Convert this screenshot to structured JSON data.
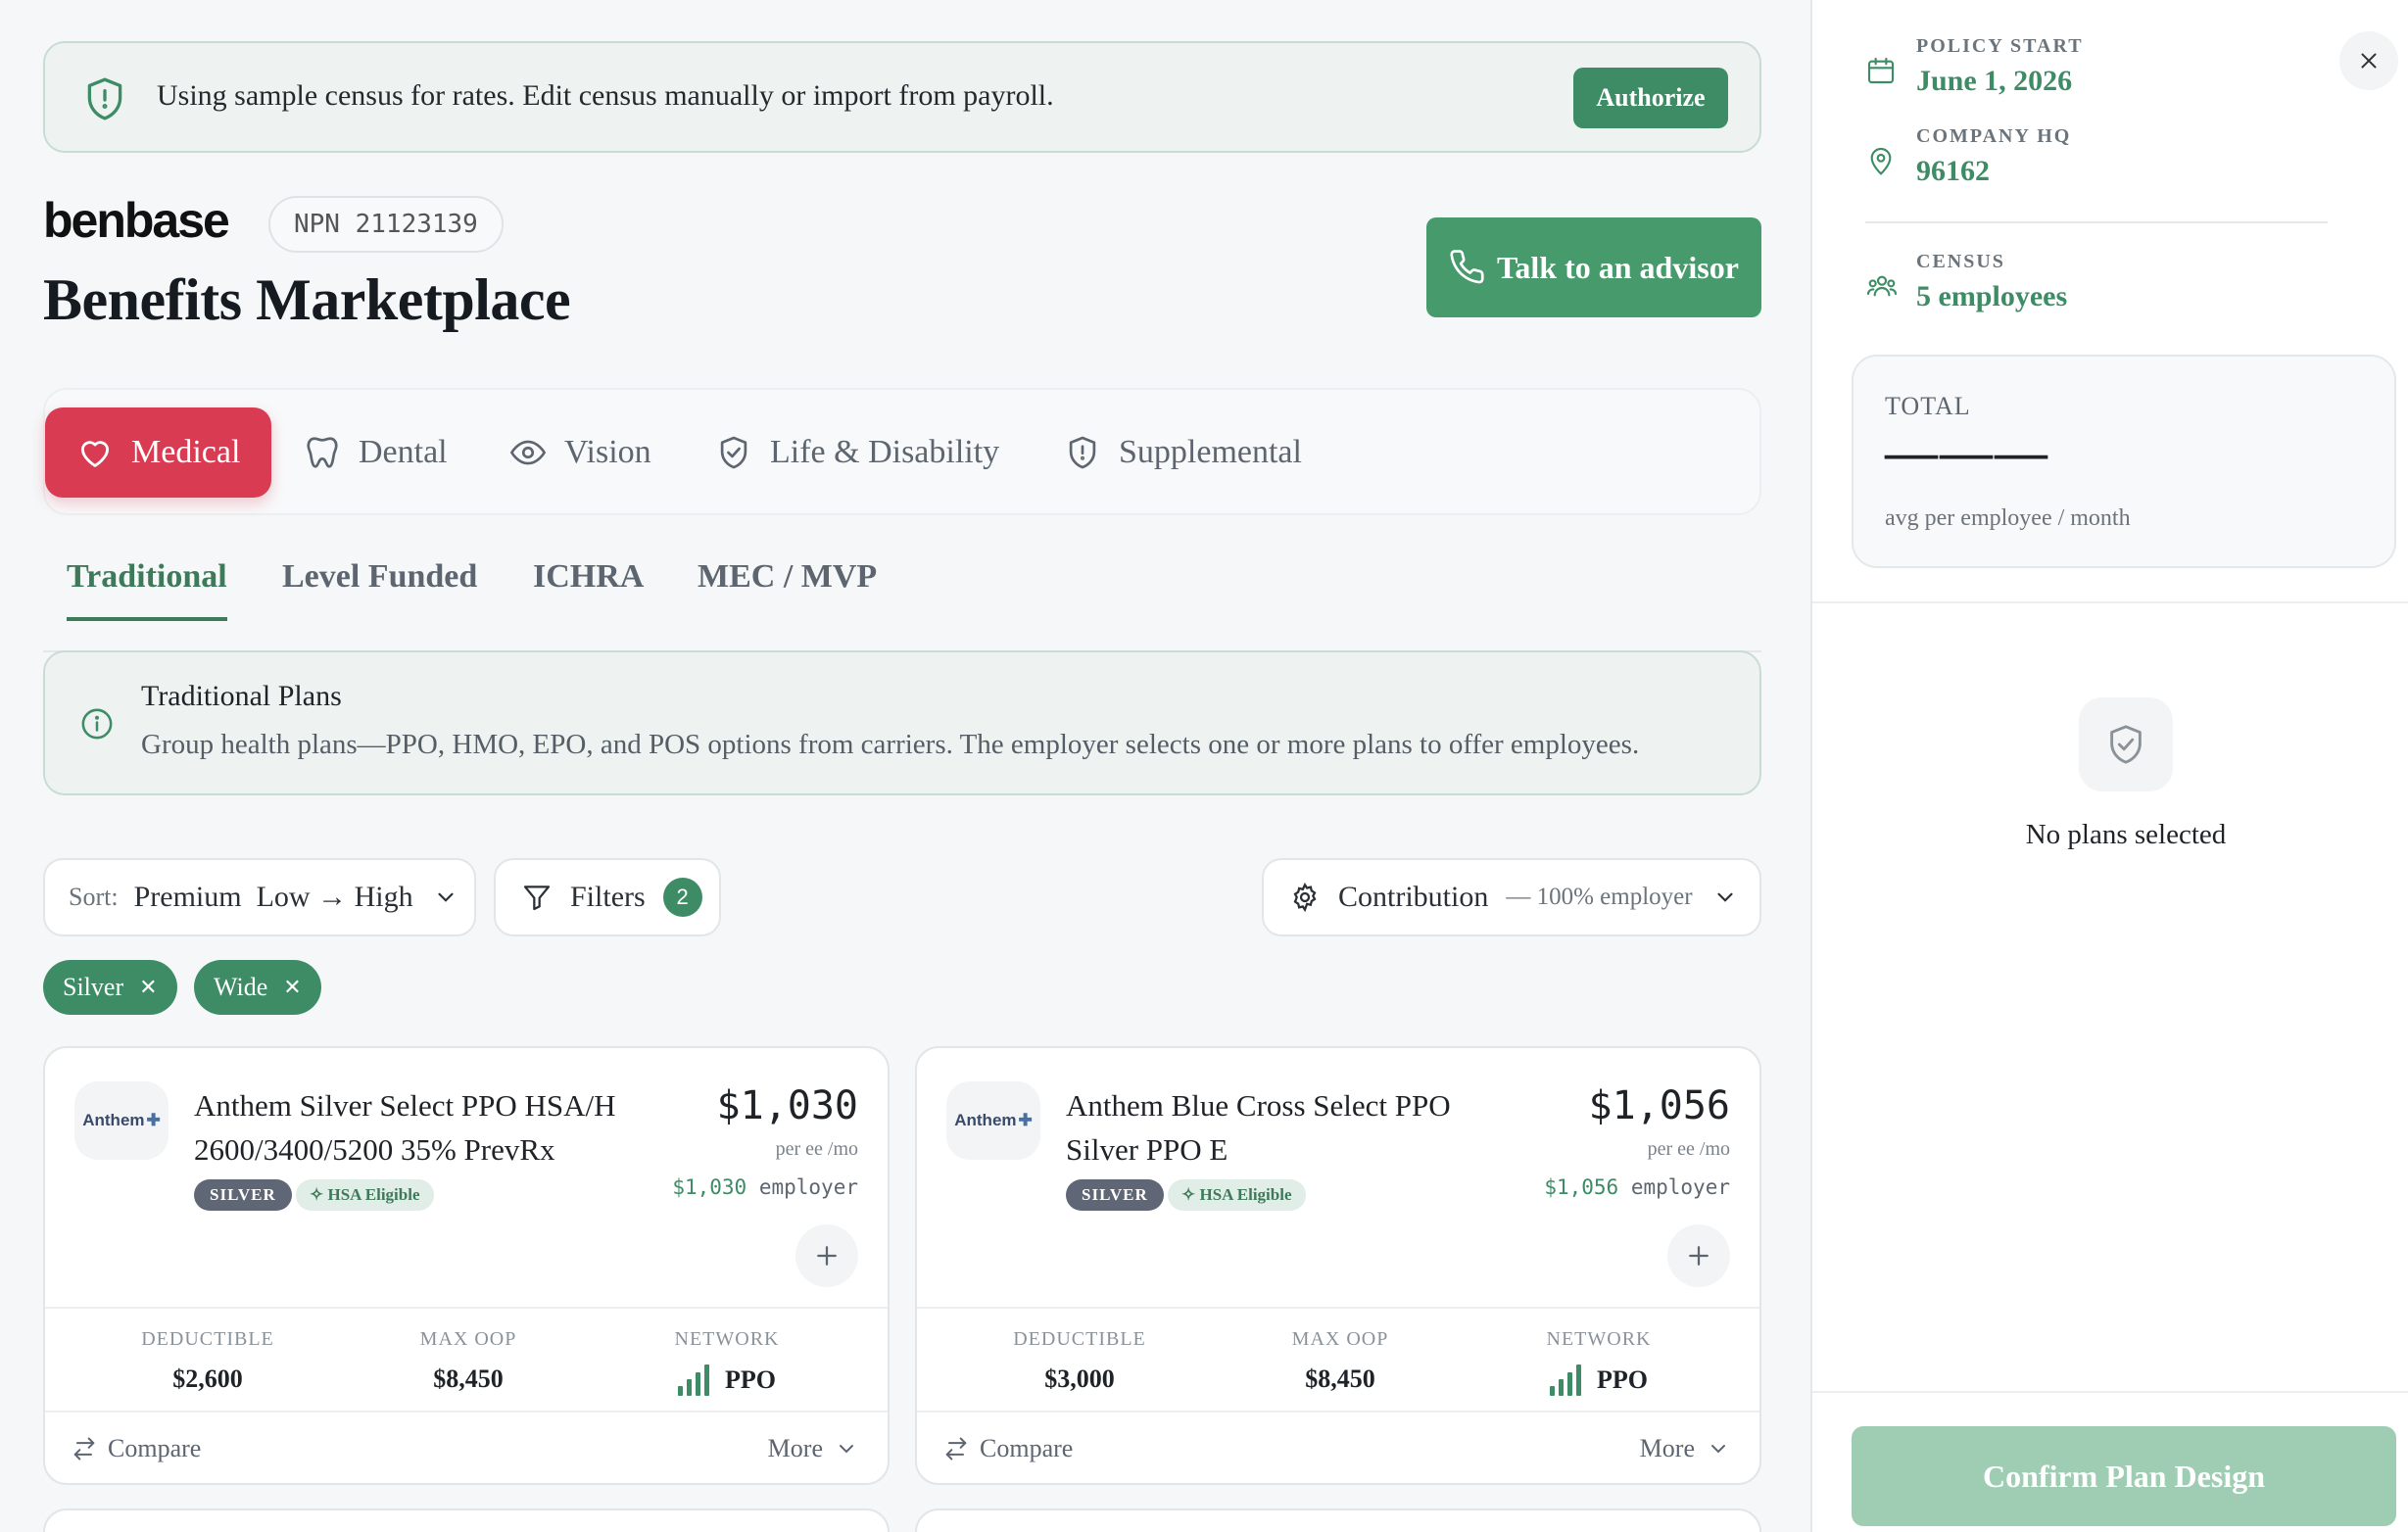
{
  "banner": {
    "text": "Using sample census for rates. Edit census manually or import from payroll.",
    "button": "Authorize"
  },
  "header": {
    "logo": "benbase",
    "npn": "NPN 21123139",
    "title": "Benefits Marketplace",
    "advisor_button": "Talk to an advisor"
  },
  "categories": [
    {
      "label": "Medical",
      "icon": "heart-icon",
      "active": true
    },
    {
      "label": "Dental",
      "icon": "tooth-icon"
    },
    {
      "label": "Vision",
      "icon": "eye-icon"
    },
    {
      "label": "Life & Disability",
      "icon": "shield-check-icon"
    },
    {
      "label": "Supplemental",
      "icon": "shield-alert-icon"
    }
  ],
  "subtabs": [
    {
      "label": "Traditional",
      "active": true
    },
    {
      "label": "Level Funded"
    },
    {
      "label": "ICHRA"
    },
    {
      "label": "MEC / MVP"
    }
  ],
  "info": {
    "title": "Traditional Plans",
    "desc": "Group health plans—PPO, HMO, EPO, and POS options from carriers. The employer selects one or more plans to offer employees."
  },
  "controls": {
    "sort_label": "Sort:",
    "sort_value": "Premium  Low → High",
    "filters_label": "Filters",
    "filters_count": "2",
    "contribution_label": "Contribution",
    "contribution_value": "— 100% employer"
  },
  "chips": [
    "Silver",
    "Wide"
  ],
  "plans": [
    {
      "carrier_logo": "Anthem",
      "name": "Anthem Silver Select PPO HSA/H 2600/3400/5200 35% PrevRx",
      "price": "$1,030",
      "per": "per ee /mo",
      "employer_amount": "$1,030",
      "employer_label": "employer",
      "tier": "SILVER",
      "hsa": "HSA Eligible",
      "deductible_label": "DEDUCTIBLE",
      "deductible": "$2,600",
      "oop_label": "MAX OOP",
      "oop": "$8,450",
      "network_label": "NETWORK",
      "network": "PPO",
      "compare": "Compare",
      "more": "More"
    },
    {
      "carrier_logo": "Anthem",
      "name": "Anthem Blue Cross Select PPO Silver PPO E",
      "price": "$1,056",
      "per": "per ee /mo",
      "employer_amount": "$1,056",
      "employer_label": "employer",
      "tier": "SILVER",
      "hsa": "HSA Eligible",
      "deductible_label": "DEDUCTIBLE",
      "deductible": "$3,000",
      "oop_label": "MAX OOP",
      "oop": "$8,450",
      "network_label": "NETWORK",
      "network": "PPO",
      "compare": "Compare",
      "more": "More"
    }
  ],
  "sidebar": {
    "policy_start_label": "POLICY START",
    "policy_start": "June 1, 2026",
    "hq_label": "COMPANY HQ",
    "hq": "96162",
    "census_label": "CENSUS",
    "census": "5 employees",
    "total_label": "TOTAL",
    "total_value": "———",
    "total_sub": "avg per employee / month",
    "empty": "No plans selected",
    "confirm": "Confirm Plan Design"
  },
  "colors": {
    "accent": "#3d8c65",
    "medical": "#d93b52",
    "confirm_disabled": "#9fcdb4"
  }
}
